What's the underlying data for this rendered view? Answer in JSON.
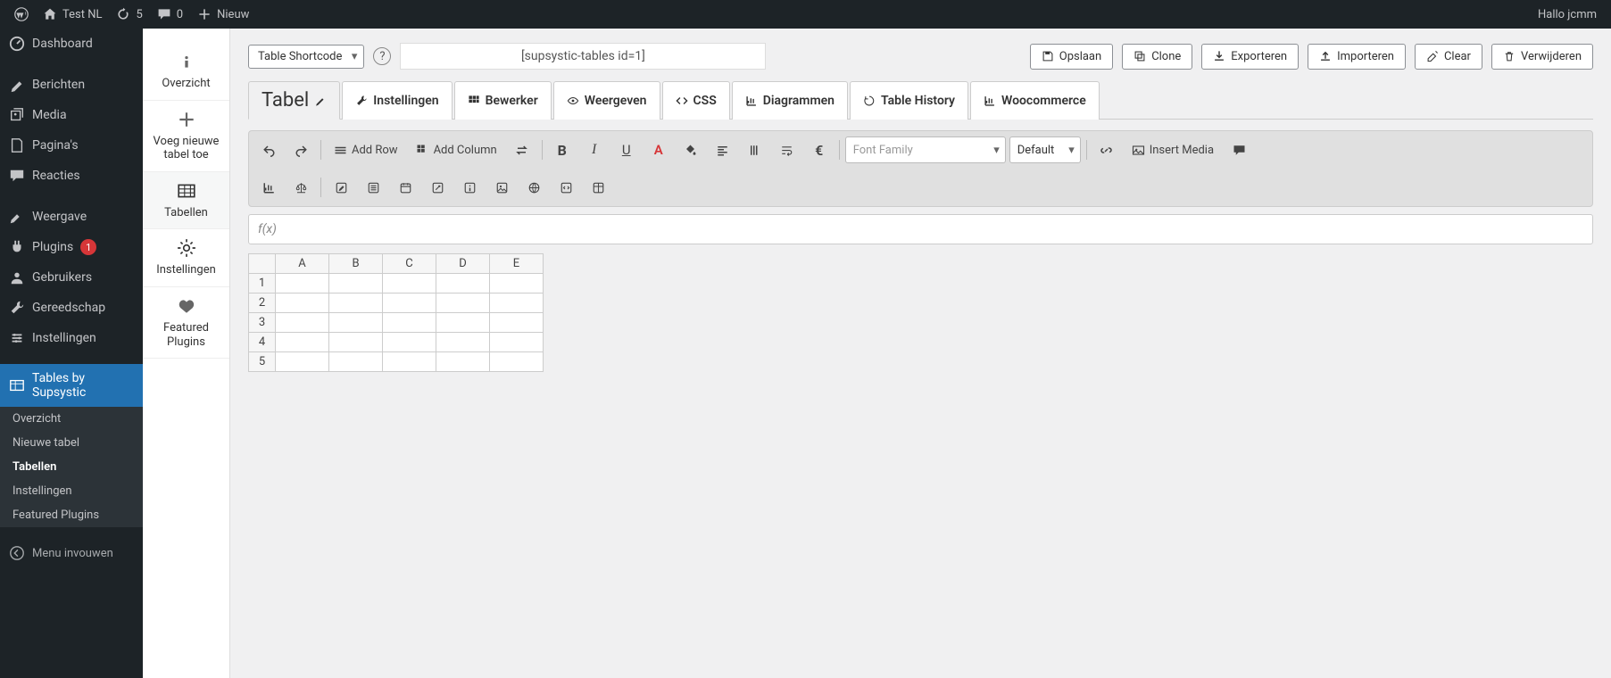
{
  "wp_bar": {
    "site_name": "Test NL",
    "updates": "5",
    "comments": "0",
    "new_label": "Nieuw",
    "greeting": "Hallo jcmm"
  },
  "admin_menu": {
    "dashboard": "Dashboard",
    "posts": "Berichten",
    "media": "Media",
    "pages": "Pagina's",
    "comments": "Reacties",
    "appearance": "Weergave",
    "plugins": "Plugins",
    "plugins_badge": "1",
    "users": "Gebruikers",
    "tools": "Gereedschap",
    "settings": "Instellingen",
    "supsystic": "Tables by Supsystic",
    "sub": {
      "overview": "Overzicht",
      "new_table": "Nieuwe tabel",
      "tables": "Tabellen",
      "settings": "Instellingen",
      "featured": "Featured Plugins"
    },
    "collapse": "Menu invouwen"
  },
  "plugin_nav": {
    "overview": "Overzicht",
    "add_new": "Voeg nieuwe tabel toe",
    "tables": "Tabellen",
    "settings": "Instellingen",
    "featured": "Featured Plugins"
  },
  "top": {
    "shortcode_dropdown": "Table Shortcode",
    "shortcode_value": "[supsystic-tables id=1]",
    "save": "Opslaan",
    "clone": "Clone",
    "export": "Exporteren",
    "import": "Importeren",
    "clear": "Clear",
    "delete": "Verwijderen"
  },
  "tabs": {
    "table": "Tabel",
    "settings": "Instellingen",
    "editor": "Bewerker",
    "view": "Weergeven",
    "css": "CSS",
    "diagrams": "Diagrammen",
    "history": "Table History",
    "woo": "Woocommerce"
  },
  "toolbar": {
    "add_row": "Add Row",
    "add_column": "Add Column",
    "font_family": "Font Family",
    "default": "Default",
    "insert_media": "Insert Media"
  },
  "fx": "f(x)",
  "sheet": {
    "cols": [
      "A",
      "B",
      "C",
      "D",
      "E"
    ],
    "rows": [
      "1",
      "2",
      "3",
      "4",
      "5"
    ]
  }
}
